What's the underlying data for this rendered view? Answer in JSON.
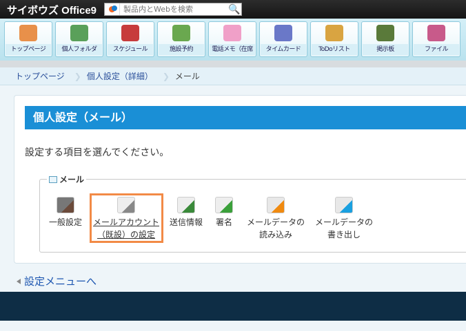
{
  "header": {
    "logo": "サイボウズ Office9",
    "search_placeholder": "製品内とWebを検索"
  },
  "toolbar": {
    "items": [
      {
        "label": "トップページ",
        "icon": "house-icon",
        "color": "#e8904a"
      },
      {
        "label": "個人フォルダ",
        "icon": "folder-icon",
        "color": "#5aa05a"
      },
      {
        "label": "スケジュール",
        "icon": "calendar-icon",
        "color": "#c73c3c"
      },
      {
        "label": "施設予約",
        "icon": "facility-icon",
        "color": "#6aa84f"
      },
      {
        "label": "電話メモ（在席",
        "icon": "phone-icon",
        "color": "#f0a0c8"
      },
      {
        "label": "タイムカード",
        "icon": "timecard-icon",
        "color": "#6a78c8"
      },
      {
        "label": "ToDoリスト",
        "icon": "todo-icon",
        "color": "#d9a441"
      },
      {
        "label": "掲示板",
        "icon": "board-icon",
        "color": "#5a7a3a"
      },
      {
        "label": "ファイル",
        "icon": "file-icon",
        "color": "#c85a8a"
      }
    ]
  },
  "breadcrumb": [
    "トップページ",
    "個人設定（詳細）",
    "メール"
  ],
  "page": {
    "title": "個人設定（メール）",
    "instruction": "設定する項目を選んでください。",
    "section": "メール"
  },
  "items": [
    {
      "line1": "一般設定",
      "line2": "",
      "icon": "tools-icon"
    },
    {
      "line1": "メールアカウント",
      "line2": "（既設）の設定",
      "icon": "mail-gear-icon"
    },
    {
      "line1": "送信情報",
      "line2": "",
      "icon": "mail-person-icon"
    },
    {
      "line1": "署名",
      "line2": "",
      "icon": "mail-pen-icon"
    },
    {
      "line1": "メールデータの",
      "line2": "読み込み",
      "icon": "import-icon"
    },
    {
      "line1": "メールデータの",
      "line2": "書き出し",
      "icon": "export-icon"
    }
  ],
  "back_link": "設定メニューへ",
  "colors": {
    "accent": "#1a8fd6",
    "selection": "#f28a46"
  }
}
